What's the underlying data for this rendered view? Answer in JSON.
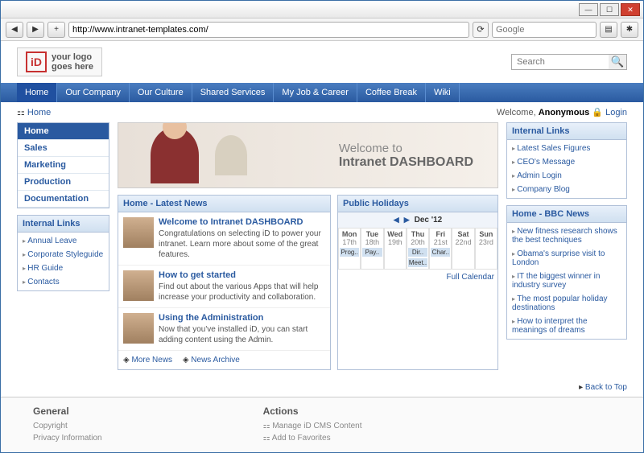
{
  "browser": {
    "url": "http://www.intranet-templates.com/",
    "search_placeholder": "Google"
  },
  "logo": {
    "line1": "your logo",
    "line2": "goes here"
  },
  "site_search_placeholder": "Search",
  "mainnav": [
    "Home",
    "Our Company",
    "Our Culture",
    "Shared Services",
    "My Job & Career",
    "Coffee Break",
    "Wiki"
  ],
  "breadcrumb": "Home",
  "welcome_prefix": "Welcome, ",
  "welcome_user": "Anonymous",
  "login_label": "Login",
  "sidenav": [
    "Home",
    "Sales",
    "Marketing",
    "Production",
    "Documentation"
  ],
  "left_links_title": "Internal Links",
  "left_links": [
    "Annual Leave",
    "Corporate Styleguide",
    "HR Guide",
    "Contacts"
  ],
  "banner": {
    "line1": "Welcome to",
    "line2": "Intranet DASHBOARD"
  },
  "news_title": "Home - Latest News",
  "news": [
    {
      "title": "Welcome to Intranet DASHBOARD",
      "body": "Congratulations on selecting iD to power your intranet. Learn more about some of the great features."
    },
    {
      "title": "How to get started",
      "body": "Find out about the various Apps that will help increase your productivity and collaboration."
    },
    {
      "title": "Using the Administration",
      "body": "Now that you've installed iD, you can start adding content using the Admin."
    }
  ],
  "more_news": "More News",
  "news_archive": "News Archive",
  "cal_title": "Public Holidays",
  "cal_month": "Dec '12",
  "cal_days": [
    {
      "d": "Mon",
      "n": "17th",
      "ev": "Prog.."
    },
    {
      "d": "Tue",
      "n": "18th",
      "ev": "Pay.."
    },
    {
      "d": "Wed",
      "n": "19th",
      "ev": ""
    },
    {
      "d": "Thu",
      "n": "20th",
      "ev": "Dir.."
    },
    {
      "d": "Fri",
      "n": "21st",
      "ev": "Char.."
    },
    {
      "d": "Sat",
      "n": "22nd",
      "ev": ""
    },
    {
      "d": "Sun",
      "n": "23rd",
      "ev": ""
    }
  ],
  "cal_meet": "Meet..",
  "full_calendar": "Full Calendar",
  "right_links_title": "Internal Links",
  "right_links": [
    "Latest Sales Figures",
    "CEO's Message",
    "Admin Login",
    "Company Blog"
  ],
  "bbc_title": "Home - BBC News",
  "bbc": [
    "New fitness research shows the best techniques",
    "Obama's surprise visit to London",
    "IT the biggest winner in industry survey",
    "The most popular holiday destinations",
    "How to interpret the meanings of dreams"
  ],
  "back_to_top": "Back to Top",
  "footer": {
    "general_title": "General",
    "general": [
      "Copyright",
      "Privacy Information"
    ],
    "actions_title": "Actions",
    "actions": [
      "Manage iD CMS Content",
      "Add to Favorites"
    ]
  }
}
